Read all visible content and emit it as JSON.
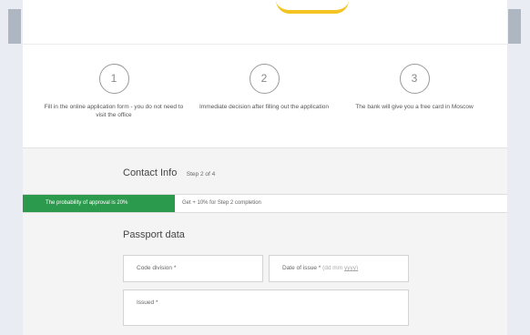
{
  "steps": [
    {
      "number": "1",
      "text": "Fill in the online application form - you do not need to visit the office"
    },
    {
      "number": "2",
      "text": "Immediate decision after filling out the application"
    },
    {
      "number": "3",
      "text": "The bank will give you a free card in Moscow"
    }
  ],
  "contact": {
    "title": "Contact Info",
    "step": "Step 2 of 4"
  },
  "progress": {
    "label": "The probability of approval is 20%",
    "value_percent": 20,
    "note": "Get + 10% for Step 2 completion"
  },
  "passport": {
    "title": "Passport data",
    "code_division": "Code division *",
    "date_of_issue": "Date of issue *",
    "date_placeholder_prefix": "(dd mm ",
    "date_placeholder_year": "yyyy)",
    "issued": "Issued *"
  },
  "colors": {
    "accent": "#f3c423",
    "success": "#2c9a4d"
  }
}
